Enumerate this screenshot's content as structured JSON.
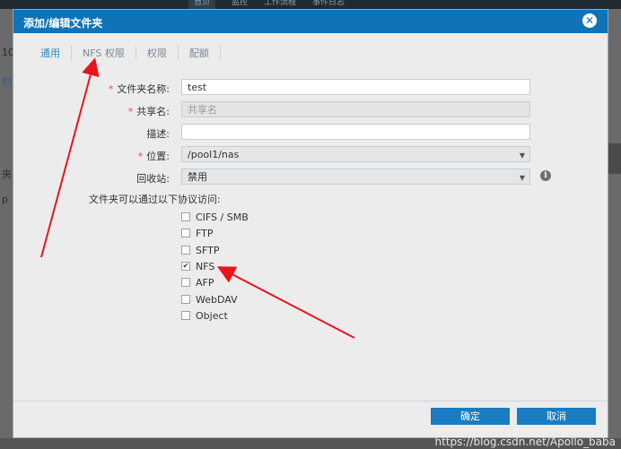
{
  "background": {
    "nav": [
      "首页",
      "监控",
      "工作流程",
      "事件日志"
    ],
    "left_fragments": [
      "10",
      "权",
      "夹",
      "p"
    ]
  },
  "dialog": {
    "title": "添加/编辑文件夹",
    "close_icon": "close-circle-icon",
    "tabs": [
      {
        "label": "通用",
        "active": true
      },
      {
        "label": "NFS 权限",
        "active": false
      },
      {
        "label": "权限",
        "active": false
      },
      {
        "label": "配额",
        "active": false
      }
    ],
    "fields": {
      "folder_name": {
        "label": "文件夹名称:",
        "required": true,
        "value": "test"
      },
      "share_name": {
        "label": "共享名:",
        "required": true,
        "placeholder": "共享名"
      },
      "description": {
        "label": "描述:",
        "required": false,
        "value": ""
      },
      "location": {
        "label": "位置:",
        "required": true,
        "value": "/pool1/nas"
      },
      "recycle_bin": {
        "label": "回收站:",
        "required": false,
        "value": "禁用"
      }
    },
    "protocols_label": "文件夹可以通过以下协议访问:",
    "protocols": [
      {
        "label": "CIFS / SMB",
        "checked": false
      },
      {
        "label": "FTP",
        "checked": false
      },
      {
        "label": "SFTP",
        "checked": false
      },
      {
        "label": "NFS",
        "checked": true
      },
      {
        "label": "AFP",
        "checked": false
      },
      {
        "label": "WebDAV",
        "checked": false
      },
      {
        "label": "Object",
        "checked": false
      }
    ],
    "ok_label": "确定",
    "cancel_label": "取消"
  },
  "watermark": "https://blog.csdn.net/Apollo_baba",
  "colors": {
    "header": "#0f73b8",
    "button": "#1a7cc1",
    "annotation_arrow": "#e8151b",
    "required": "#d9534f"
  }
}
